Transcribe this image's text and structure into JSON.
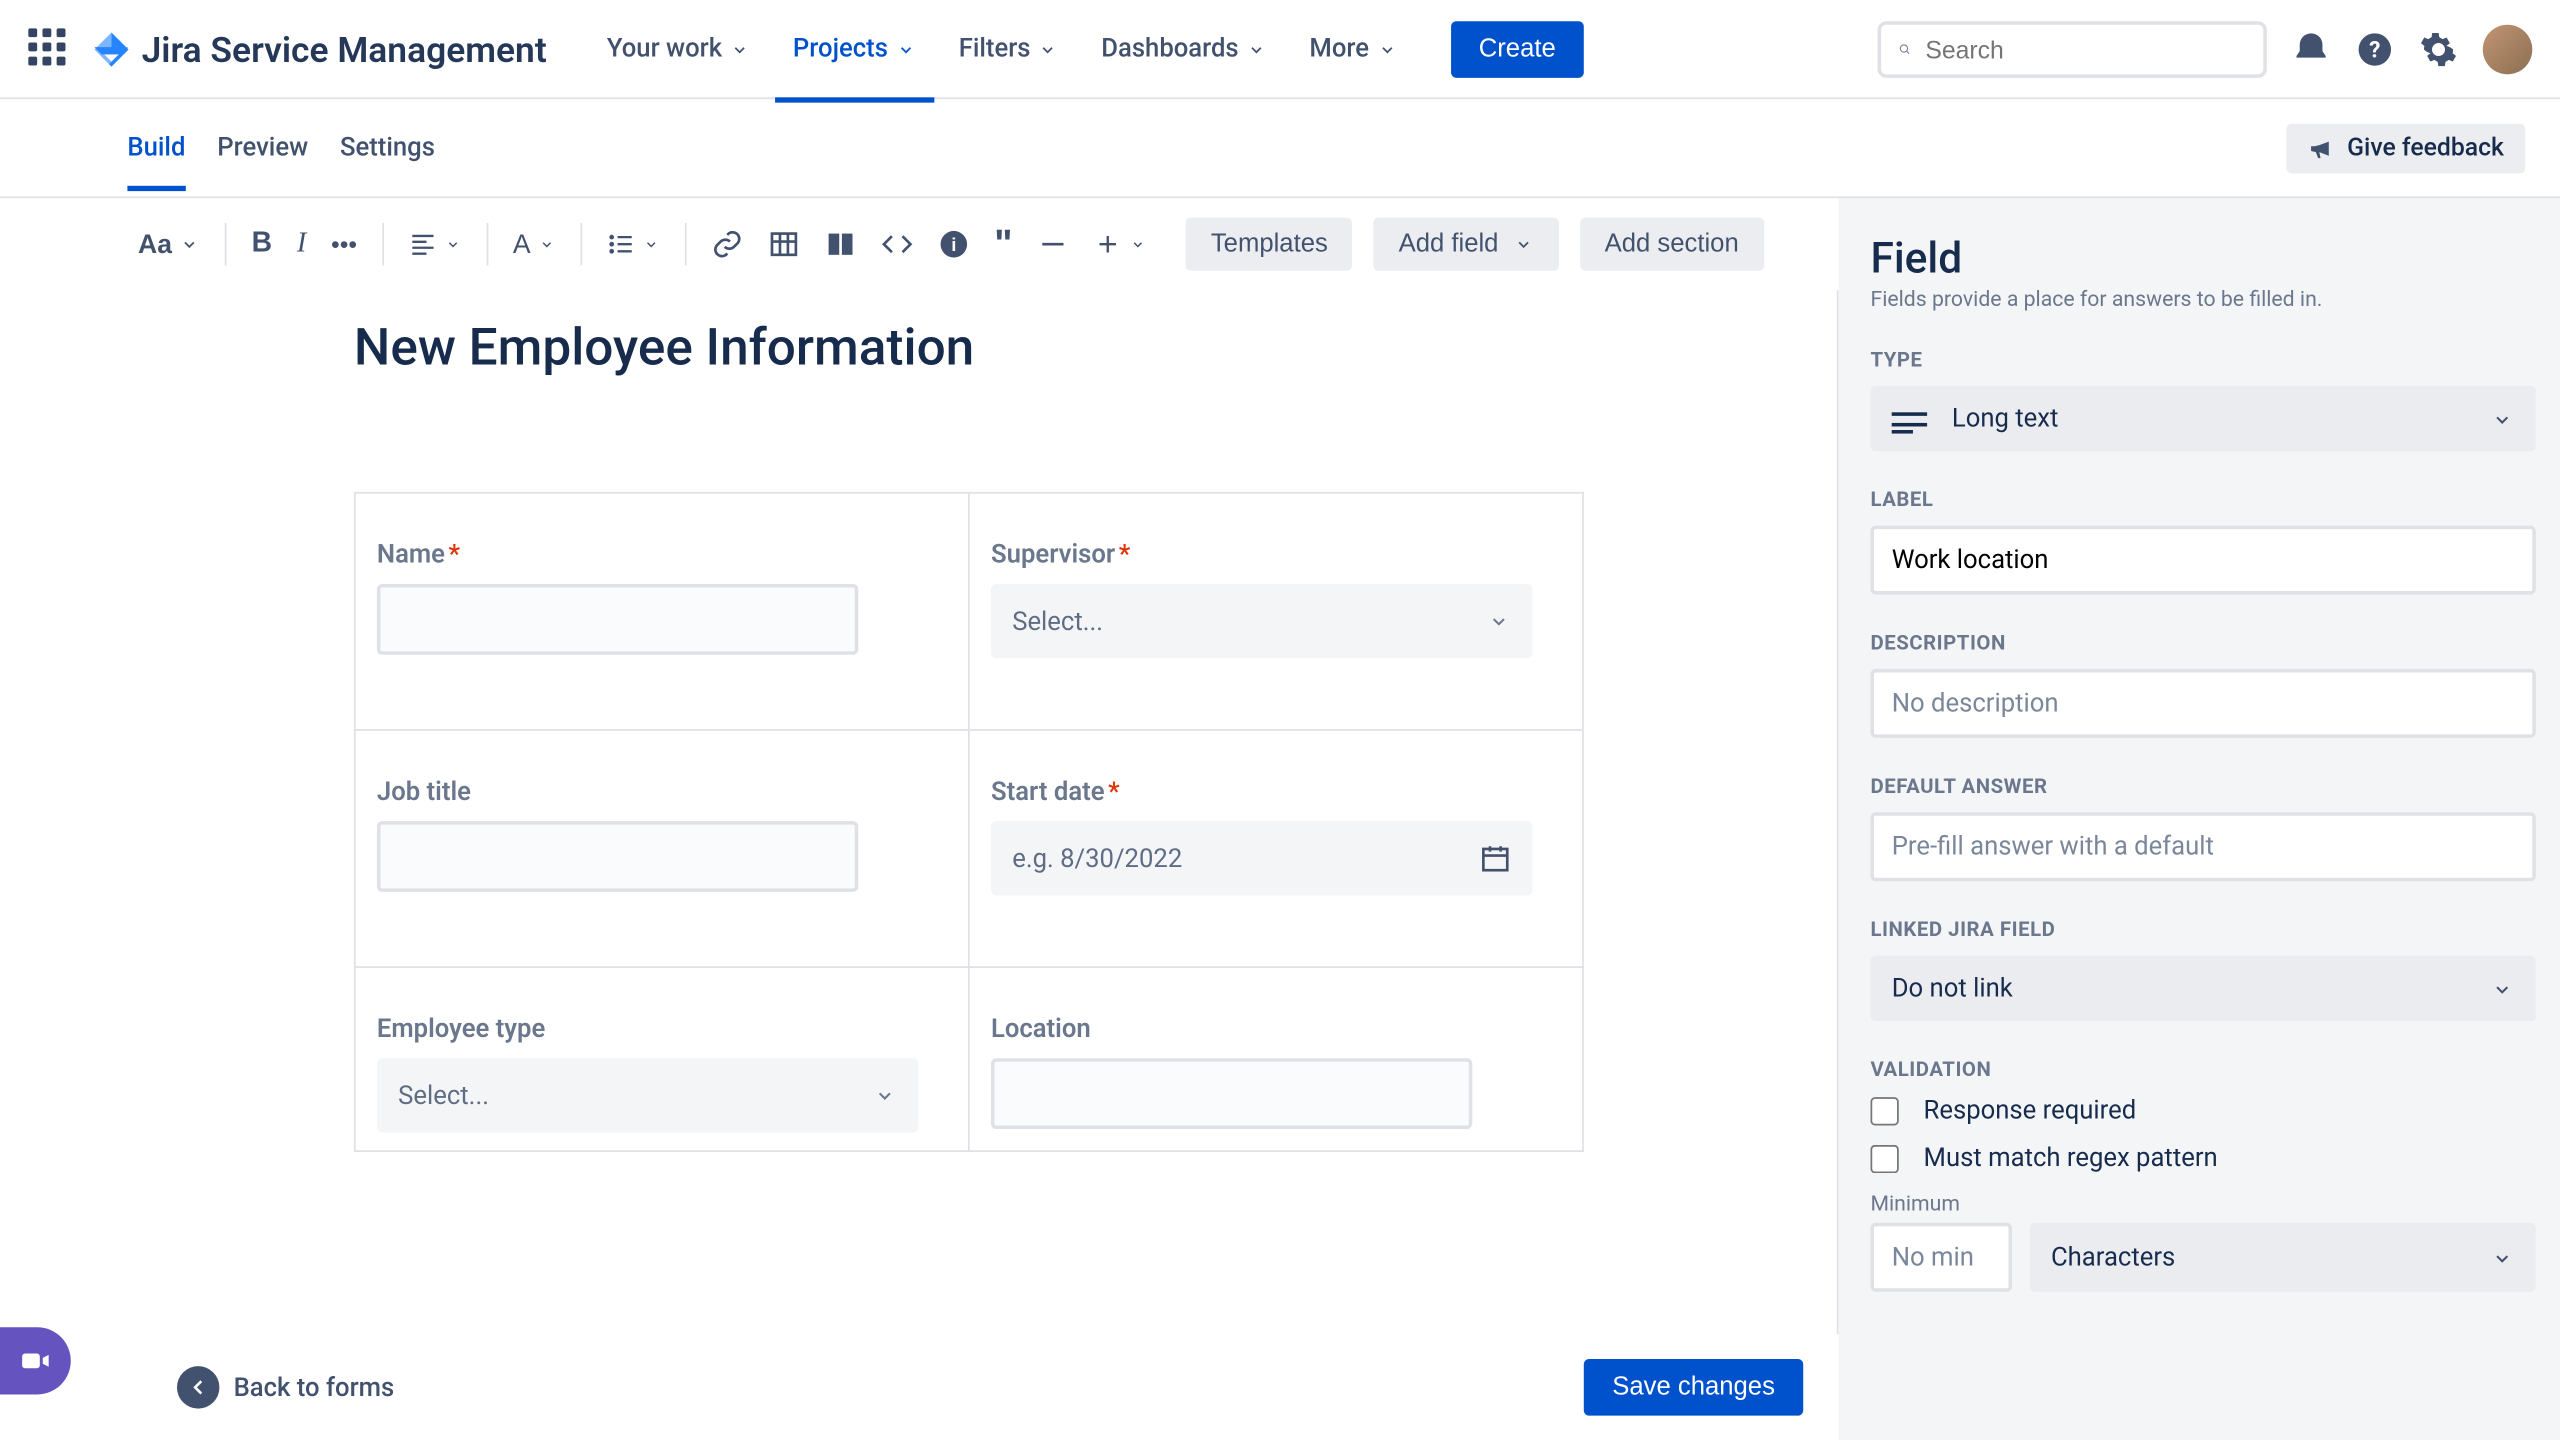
{
  "header": {
    "product": "Jira Service Management",
    "nav": {
      "your_work": "Your work",
      "projects": "Projects",
      "filters": "Filters",
      "dashboards": "Dashboards",
      "more": "More"
    },
    "create": "Create",
    "search_placeholder": "Search"
  },
  "tabs": {
    "build": "Build",
    "preview": "Preview",
    "settings": "Settings"
  },
  "feedback": "Give feedback",
  "toolbar": {
    "text_styles": "Aa",
    "templates": "Templates",
    "add_field": "Add field",
    "add_section": "Add section"
  },
  "form": {
    "title": "New Employee Information",
    "fields": {
      "name": {
        "label": "Name"
      },
      "supervisor": {
        "label": "Supervisor",
        "placeholder": "Select..."
      },
      "job_title": {
        "label": "Job title"
      },
      "start_date": {
        "label": "Start date",
        "placeholder": "e.g. 8/30/2022"
      },
      "employee_type": {
        "label": "Employee type",
        "placeholder": "Select..."
      },
      "location": {
        "label": "Location"
      }
    }
  },
  "footer": {
    "back": "Back to forms",
    "save": "Save changes"
  },
  "panel": {
    "title": "Field",
    "subtitle": "Fields provide a place for answers to be filled in.",
    "type_heading": "Type",
    "type_value": "Long text",
    "label_heading": "Label",
    "label_value": "Work location",
    "description_heading": "Description",
    "description_placeholder": "No description",
    "default_heading": "Default Answer",
    "default_placeholder": "Pre-fill answer with a default",
    "linked_heading": "Linked Jira Field",
    "linked_value": "Do not link",
    "validation_heading": "Validation",
    "response_required": "Response required",
    "regex_match": "Must match regex pattern",
    "minimum_label": "Minimum",
    "minimum_placeholder": "No min",
    "characters": "Characters"
  }
}
